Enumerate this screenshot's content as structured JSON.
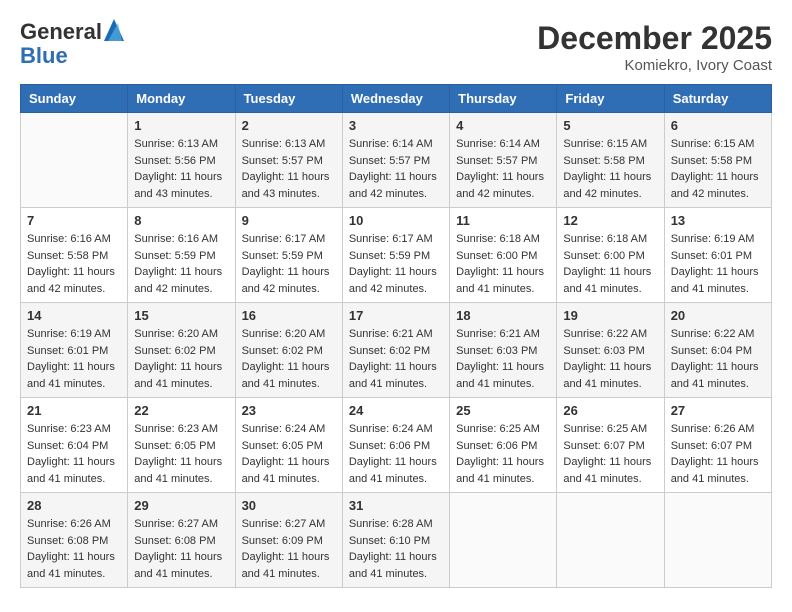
{
  "header": {
    "logo_line1": "General",
    "logo_line2": "Blue",
    "month": "December 2025",
    "location": "Komiekro, Ivory Coast"
  },
  "weekdays": [
    "Sunday",
    "Monday",
    "Tuesday",
    "Wednesday",
    "Thursday",
    "Friday",
    "Saturday"
  ],
  "weeks": [
    [
      {
        "day": "",
        "info": ""
      },
      {
        "day": "1",
        "info": "Sunrise: 6:13 AM\nSunset: 5:56 PM\nDaylight: 11 hours\nand 43 minutes."
      },
      {
        "day": "2",
        "info": "Sunrise: 6:13 AM\nSunset: 5:57 PM\nDaylight: 11 hours\nand 43 minutes."
      },
      {
        "day": "3",
        "info": "Sunrise: 6:14 AM\nSunset: 5:57 PM\nDaylight: 11 hours\nand 42 minutes."
      },
      {
        "day": "4",
        "info": "Sunrise: 6:14 AM\nSunset: 5:57 PM\nDaylight: 11 hours\nand 42 minutes."
      },
      {
        "day": "5",
        "info": "Sunrise: 6:15 AM\nSunset: 5:58 PM\nDaylight: 11 hours\nand 42 minutes."
      },
      {
        "day": "6",
        "info": "Sunrise: 6:15 AM\nSunset: 5:58 PM\nDaylight: 11 hours\nand 42 minutes."
      }
    ],
    [
      {
        "day": "7",
        "info": "Sunrise: 6:16 AM\nSunset: 5:58 PM\nDaylight: 11 hours\nand 42 minutes."
      },
      {
        "day": "8",
        "info": "Sunrise: 6:16 AM\nSunset: 5:59 PM\nDaylight: 11 hours\nand 42 minutes."
      },
      {
        "day": "9",
        "info": "Sunrise: 6:17 AM\nSunset: 5:59 PM\nDaylight: 11 hours\nand 42 minutes."
      },
      {
        "day": "10",
        "info": "Sunrise: 6:17 AM\nSunset: 5:59 PM\nDaylight: 11 hours\nand 42 minutes."
      },
      {
        "day": "11",
        "info": "Sunrise: 6:18 AM\nSunset: 6:00 PM\nDaylight: 11 hours\nand 41 minutes."
      },
      {
        "day": "12",
        "info": "Sunrise: 6:18 AM\nSunset: 6:00 PM\nDaylight: 11 hours\nand 41 minutes."
      },
      {
        "day": "13",
        "info": "Sunrise: 6:19 AM\nSunset: 6:01 PM\nDaylight: 11 hours\nand 41 minutes."
      }
    ],
    [
      {
        "day": "14",
        "info": "Sunrise: 6:19 AM\nSunset: 6:01 PM\nDaylight: 11 hours\nand 41 minutes."
      },
      {
        "day": "15",
        "info": "Sunrise: 6:20 AM\nSunset: 6:02 PM\nDaylight: 11 hours\nand 41 minutes."
      },
      {
        "day": "16",
        "info": "Sunrise: 6:20 AM\nSunset: 6:02 PM\nDaylight: 11 hours\nand 41 minutes."
      },
      {
        "day": "17",
        "info": "Sunrise: 6:21 AM\nSunset: 6:02 PM\nDaylight: 11 hours\nand 41 minutes."
      },
      {
        "day": "18",
        "info": "Sunrise: 6:21 AM\nSunset: 6:03 PM\nDaylight: 11 hours\nand 41 minutes."
      },
      {
        "day": "19",
        "info": "Sunrise: 6:22 AM\nSunset: 6:03 PM\nDaylight: 11 hours\nand 41 minutes."
      },
      {
        "day": "20",
        "info": "Sunrise: 6:22 AM\nSunset: 6:04 PM\nDaylight: 11 hours\nand 41 minutes."
      }
    ],
    [
      {
        "day": "21",
        "info": "Sunrise: 6:23 AM\nSunset: 6:04 PM\nDaylight: 11 hours\nand 41 minutes."
      },
      {
        "day": "22",
        "info": "Sunrise: 6:23 AM\nSunset: 6:05 PM\nDaylight: 11 hours\nand 41 minutes."
      },
      {
        "day": "23",
        "info": "Sunrise: 6:24 AM\nSunset: 6:05 PM\nDaylight: 11 hours\nand 41 minutes."
      },
      {
        "day": "24",
        "info": "Sunrise: 6:24 AM\nSunset: 6:06 PM\nDaylight: 11 hours\nand 41 minutes."
      },
      {
        "day": "25",
        "info": "Sunrise: 6:25 AM\nSunset: 6:06 PM\nDaylight: 11 hours\nand 41 minutes."
      },
      {
        "day": "26",
        "info": "Sunrise: 6:25 AM\nSunset: 6:07 PM\nDaylight: 11 hours\nand 41 minutes."
      },
      {
        "day": "27",
        "info": "Sunrise: 6:26 AM\nSunset: 6:07 PM\nDaylight: 11 hours\nand 41 minutes."
      }
    ],
    [
      {
        "day": "28",
        "info": "Sunrise: 6:26 AM\nSunset: 6:08 PM\nDaylight: 11 hours\nand 41 minutes."
      },
      {
        "day": "29",
        "info": "Sunrise: 6:27 AM\nSunset: 6:08 PM\nDaylight: 11 hours\nand 41 minutes."
      },
      {
        "day": "30",
        "info": "Sunrise: 6:27 AM\nSunset: 6:09 PM\nDaylight: 11 hours\nand 41 minutes."
      },
      {
        "day": "31",
        "info": "Sunrise: 6:28 AM\nSunset: 6:10 PM\nDaylight: 11 hours\nand 41 minutes."
      },
      {
        "day": "",
        "info": ""
      },
      {
        "day": "",
        "info": ""
      },
      {
        "day": "",
        "info": ""
      }
    ]
  ]
}
